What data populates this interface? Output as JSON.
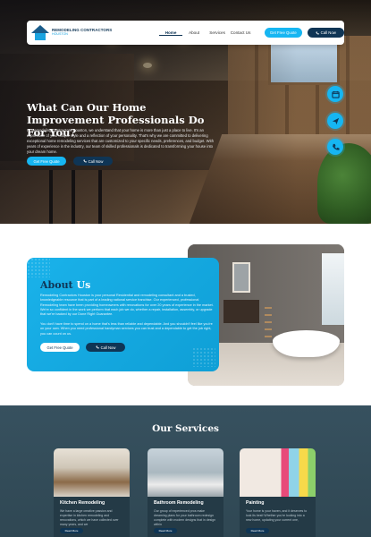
{
  "nav": {
    "logo_line1": "REMODELING CONTRACTORS",
    "logo_line2": "HOUSTON",
    "links": [
      "Home",
      "About",
      "Services",
      "Contact Us"
    ],
    "quote_label": "Get Free Quote",
    "call_label": "Call Now"
  },
  "hero": {
    "title": "What Can Our Home Improvement Professionals Do For You?",
    "body": "At Remodeling Contractors Houston, we understand that your home is more than just a place to live. It's an expression of your unique style and a reflection of your personality. That's why we are committed to delivering exceptional home remodeling services that are customized to your specific needs, preferences, and budget. With years of experience in the industry, our team of skilled professionals is dedicated to transforming your house into your dream home.",
    "quote_label": "Get Free Quote",
    "call_label": "Call Now"
  },
  "floating_icons": [
    "calendar-icon",
    "send-icon",
    "phone-icon"
  ],
  "about": {
    "title_part1": "About",
    "title_part2": "Us",
    "p1": "Remodeling Contractors Houston is your personal Residential and remodeling consultant and a trusted, knowledgeable resource that is part of a leading national service franchise. Our experienced, professional Remodeling team have been providing homeowners with renovations for over 20 years of experience in the market. We're so confident in the work we perform that each job we do, whether a repair, installation, assembly, or upgrade that we're backed by our Done Right Guarantee.",
    "p2": "You don't have time to spend on a home that's less than reliable and dependable. And you shouldn't feel like you're on your own. When you need professional handyman services you can trust and a dependable to get the job right, you can count on us.",
    "quote_label": "Get Free Quote",
    "call_label": "Call Now"
  },
  "services": {
    "title": "Our Services",
    "cards": [
      {
        "title": "Kitchen Remodeling",
        "body": "We have a large creative passion and expertise in kitchen remodeling and renovations, which we have collected over many years, and we",
        "button": "Read More"
      },
      {
        "title": "Bathroom Remodeling",
        "body": "Our group of experienced pros make dreaming plans for your bathroom redesign complete with modern designs that in design within",
        "button": "Read More"
      },
      {
        "title": "Painting",
        "body": "Your home is your haven, and it deserves to look its best! Whether you're looking into a new home, updating your current one,",
        "button": "Read More"
      }
    ]
  },
  "colors": {
    "accent": "#16b6f2",
    "navy": "#0f3555",
    "services_bg": "#37515f"
  }
}
